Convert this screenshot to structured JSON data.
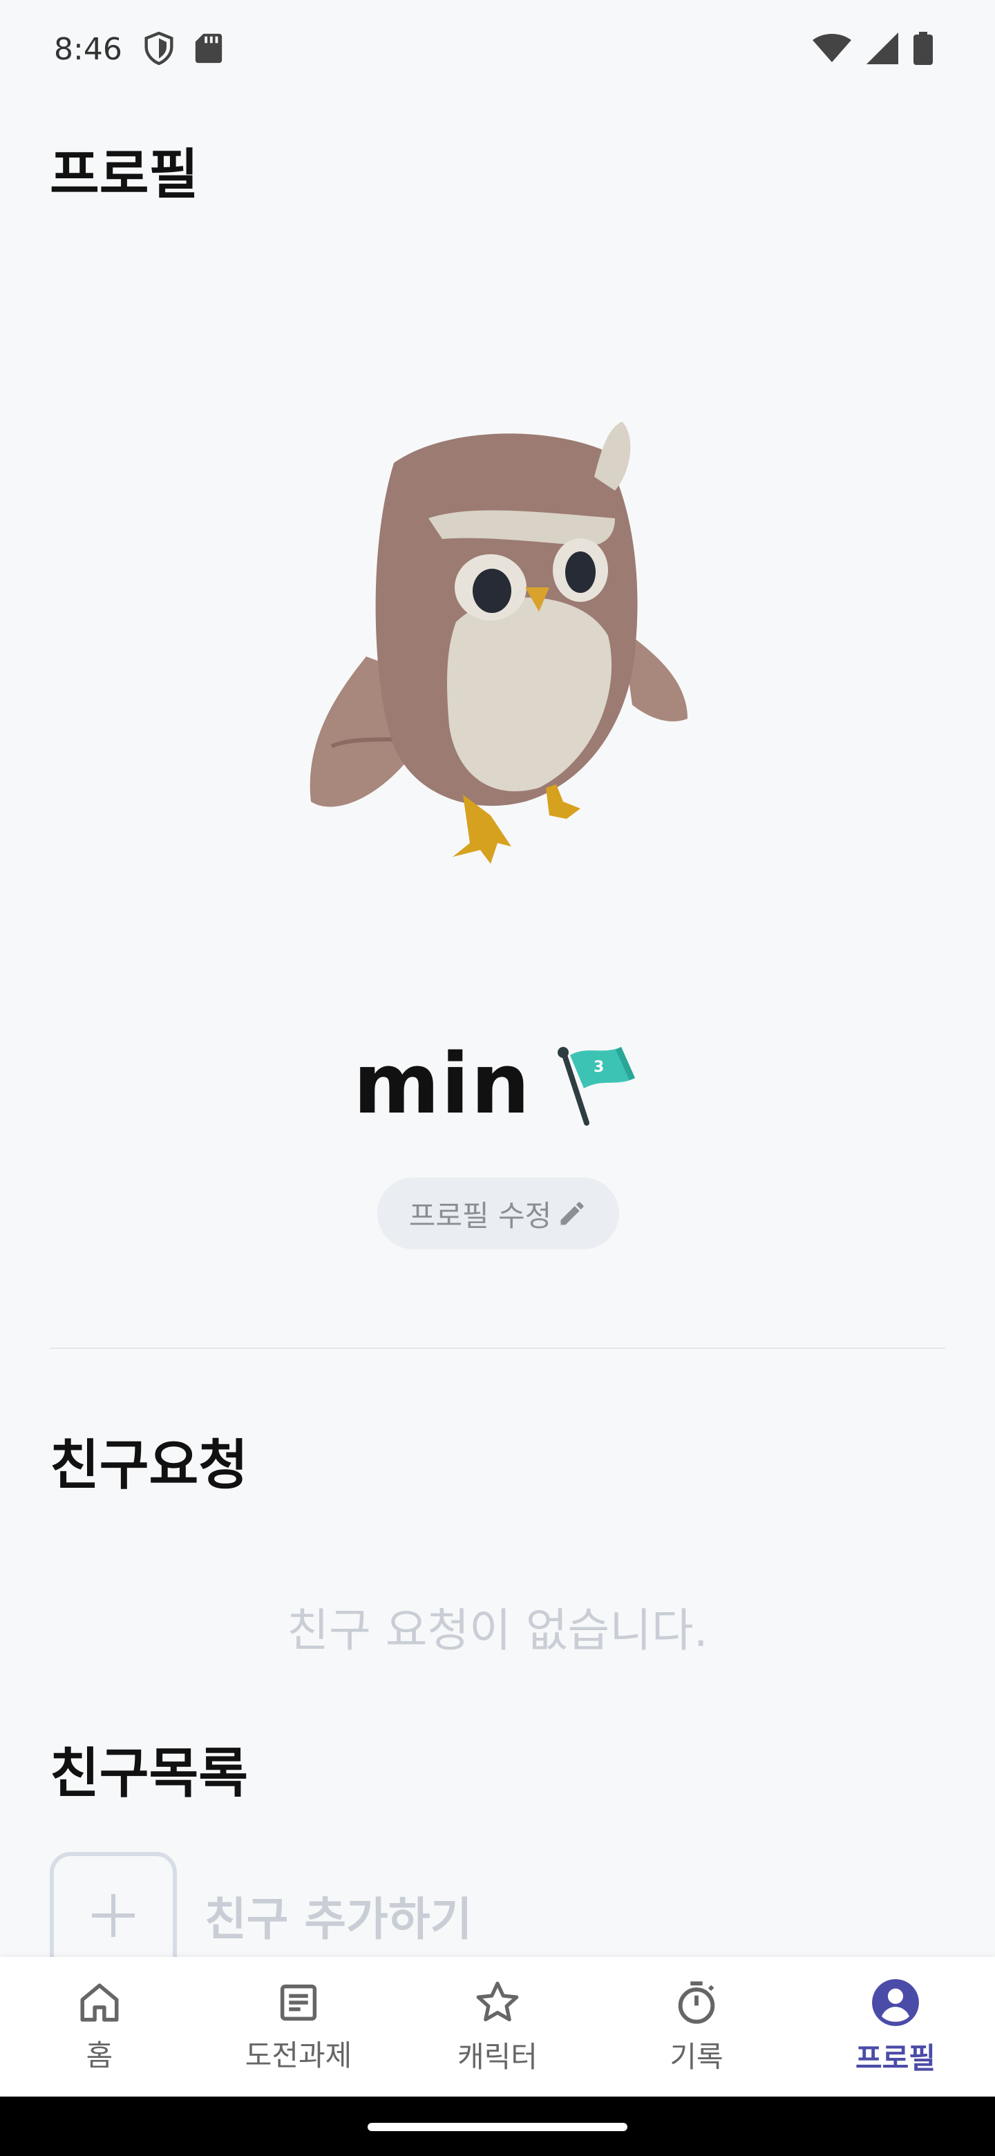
{
  "status_bar": {
    "time": "8:46",
    "left_icons": [
      "shield-icon",
      "sd-card-icon"
    ],
    "right_icons": [
      "wifi-icon",
      "signal-icon",
      "battery-icon"
    ]
  },
  "header": {
    "title": "프로필"
  },
  "profile": {
    "name": "min",
    "level_flag_number": "3",
    "edit_label": "프로필 수정"
  },
  "friend_requests": {
    "title": "친구요청",
    "empty_text": "친구 요청이 없습니다."
  },
  "friends": {
    "title": "친구목록",
    "add_label": "친구 추가하기"
  },
  "bottom_nav": {
    "items": [
      {
        "label": "홈",
        "icon": "home-icon"
      },
      {
        "label": "도전과제",
        "icon": "document-icon"
      },
      {
        "label": "캐릭터",
        "icon": "star-icon"
      },
      {
        "label": "기록",
        "icon": "timer-icon"
      },
      {
        "label": "프로필",
        "icon": "person-icon",
        "active": true
      }
    ]
  },
  "colors": {
    "accent": "#4b4ba8",
    "background": "#f7f8f9",
    "flag": "#3cc3b4"
  }
}
